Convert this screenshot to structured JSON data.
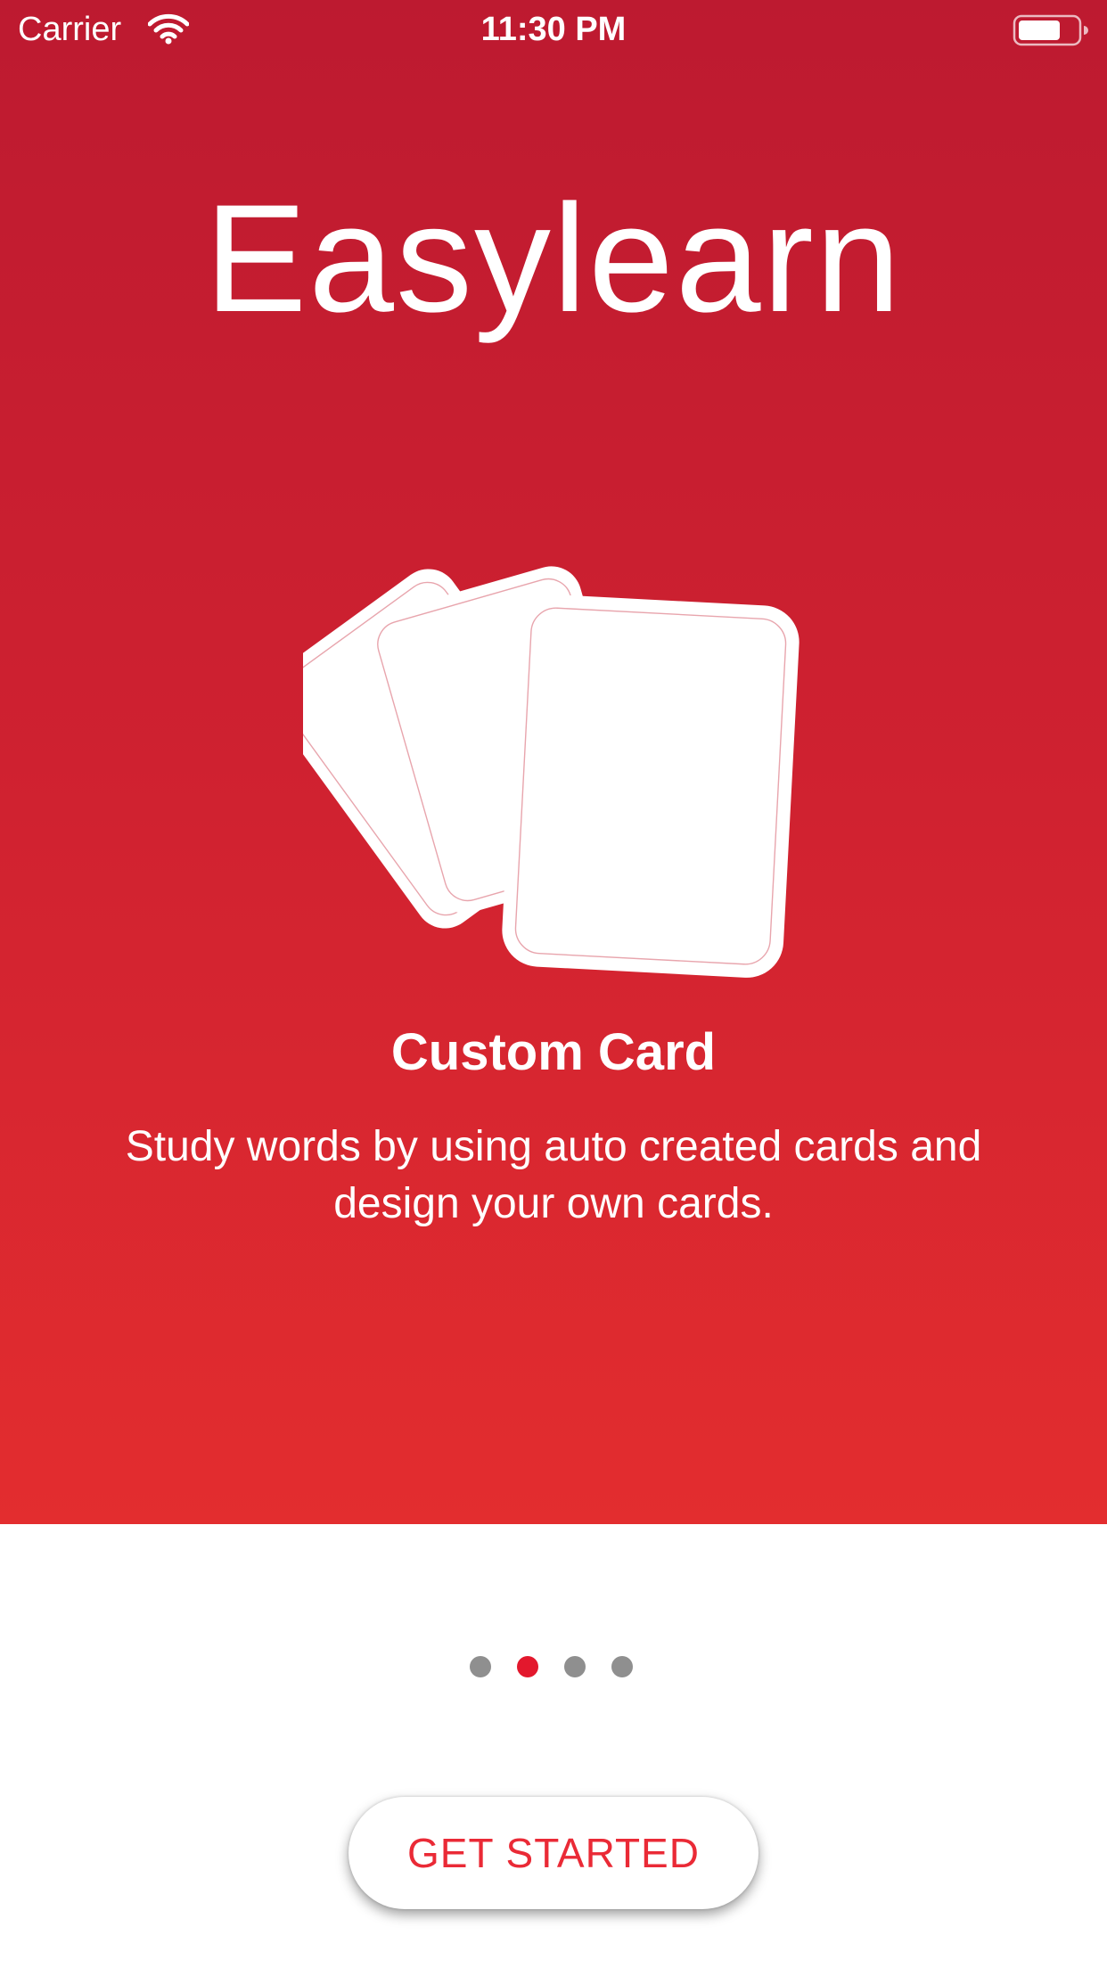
{
  "status_bar": {
    "carrier": "Carrier",
    "time": "11:30 PM",
    "icons": [
      "wifi-icon",
      "battery-icon"
    ]
  },
  "onboarding": {
    "app_title": "Easylearn",
    "illustration": "cards-icon",
    "feature_title": "Custom Card",
    "feature_description": "Study words by using auto created cards and design your own cards.",
    "pager": {
      "total_pages": 4,
      "current_page": 2
    },
    "cta_label": "GET STARTED"
  },
  "colors": {
    "gradient_top": "#bd1a30",
    "gradient_bottom": "#e32d2f",
    "accent": "#e3182d",
    "inactive_dot": "#8f8f8f",
    "button_text": "#ea2a36",
    "background": "#ffffff"
  }
}
